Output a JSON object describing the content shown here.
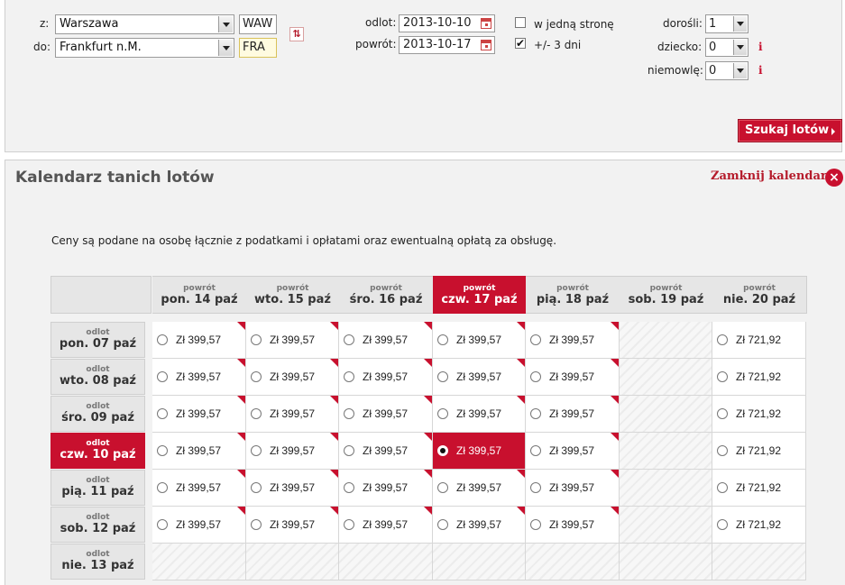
{
  "search": {
    "from_label": "z:",
    "from_value": "Warszawa",
    "from_code": "WAW",
    "to_label": "do:",
    "to_value": "Frankfurt n.M.",
    "to_code": "FRA",
    "swap_icon": "swap-icon",
    "depart_label": "odlot:",
    "depart_date": "2013-10-10",
    "return_label": "powrót:",
    "return_date": "2013-10-17",
    "one_way_label": "w jedną stronę",
    "one_way_checked": false,
    "flex_label": "+/- 3 dni",
    "flex_checked": true,
    "adults_label": "dorośli:",
    "adults_value": "1",
    "children_label": "dziecko:",
    "children_value": "0",
    "infants_label": "niemowlę:",
    "infants_value": "0",
    "info_glyph": "i",
    "search_button": "Szukaj lotów"
  },
  "calendar": {
    "title": "Kalendarz tanich lotów",
    "close_label": "Zamknij kalendarz",
    "close_glyph": "×",
    "note": "Ceny są podane na osobę łącznie z podatkami i opłatami oraz ewentualną opłatą za obsługę.",
    "return_word": "powrót",
    "depart_word": "odlot",
    "return_days": [
      "pon. 14 paź",
      "wto. 15 paź",
      "śro. 16 paź",
      "czw. 17 paź",
      "pią. 18 paź",
      "sob. 19 paź",
      "nie. 20 paź"
    ],
    "depart_days": [
      "pon. 07 paź",
      "wto. 08 paź",
      "śro. 09 paź",
      "czw. 10 paź",
      "pią. 11 paź",
      "sob. 12 paź",
      "nie. 13 paź"
    ],
    "selected_return_index": 3,
    "selected_depart_index": 3,
    "prices": [
      [
        "Zł 399,57",
        "Zł 399,57",
        "Zł 399,57",
        "Zł 399,57",
        "Zł 399,57",
        null,
        "Zł 721,92"
      ],
      [
        "Zł 399,57",
        "Zł 399,57",
        "Zł 399,57",
        "Zł 399,57",
        "Zł 399,57",
        null,
        "Zł 721,92"
      ],
      [
        "Zł 399,57",
        "Zł 399,57",
        "Zł 399,57",
        "Zł 399,57",
        "Zł 399,57",
        null,
        "Zł 721,92"
      ],
      [
        "Zł 399,57",
        "Zł 399,57",
        "Zł 399,57",
        "Zł 399,57",
        "Zł 399,57",
        null,
        "Zł 721,92"
      ],
      [
        "Zł 399,57",
        "Zł 399,57",
        "Zł 399,57",
        "Zł 399,57",
        "Zł 399,57",
        null,
        "Zł 721,92"
      ],
      [
        "Zł 399,57",
        "Zł 399,57",
        "Zł 399,57",
        "Zł 399,57",
        "Zł 399,57",
        null,
        "Zł 721,92"
      ],
      [
        null,
        null,
        null,
        null,
        null,
        null,
        null
      ]
    ],
    "flagged_columns": [
      0,
      1,
      2,
      3,
      4
    ],
    "accent_color": "#c8102e"
  }
}
